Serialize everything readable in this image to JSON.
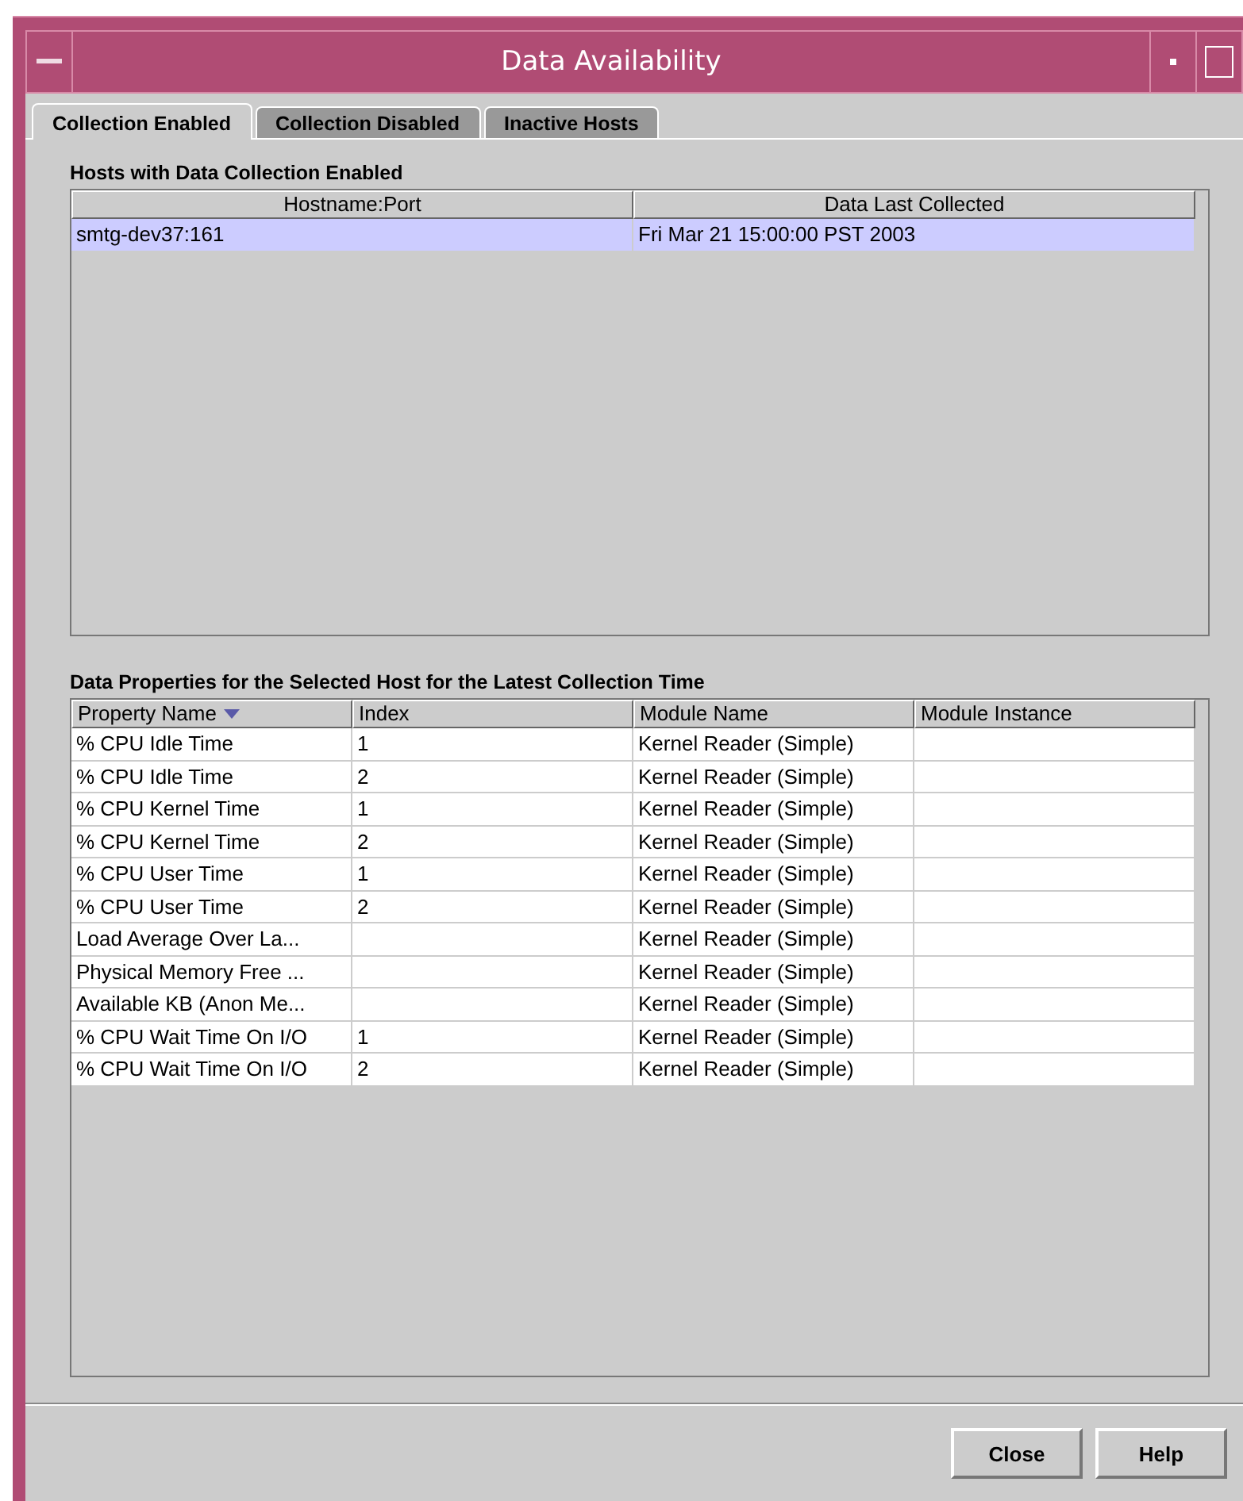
{
  "window": {
    "title": "Data Availability"
  },
  "tabs": [
    {
      "label": "Collection Enabled",
      "selected": true
    },
    {
      "label": "Collection Disabled",
      "selected": false
    },
    {
      "label": "Inactive Hosts",
      "selected": false
    }
  ],
  "hosts": {
    "title": "Hosts with Data Collection Enabled",
    "columns": [
      {
        "label": "Hostname:Port"
      },
      {
        "label": "Data Last Collected"
      }
    ],
    "rows": [
      {
        "selected": true,
        "cells": [
          "smtg-dev37:161",
          "Fri Mar 21 15:00:00 PST 2003"
        ]
      }
    ]
  },
  "properties": {
    "title": "Data Properties for the Selected Host for the Latest Collection Time",
    "columns": [
      {
        "label": "Property Name",
        "sorted": true
      },
      {
        "label": "Index",
        "sorted": false
      },
      {
        "label": "Module Name",
        "sorted": false
      },
      {
        "label": "Module Instance",
        "sorted": false
      }
    ],
    "rows": [
      {
        "selected": false,
        "cells": [
          "% CPU Idle Time",
          "1",
          "Kernel Reader (Simple)",
          ""
        ]
      },
      {
        "selected": false,
        "cells": [
          "% CPU Idle Time",
          "2",
          "Kernel Reader (Simple)",
          ""
        ]
      },
      {
        "selected": false,
        "cells": [
          "% CPU Kernel Time",
          "1",
          "Kernel Reader (Simple)",
          ""
        ]
      },
      {
        "selected": false,
        "cells": [
          "% CPU Kernel Time",
          "2",
          "Kernel Reader (Simple)",
          ""
        ]
      },
      {
        "selected": false,
        "cells": [
          "% CPU User Time",
          "1",
          "Kernel Reader (Simple)",
          ""
        ]
      },
      {
        "selected": false,
        "cells": [
          "% CPU User Time",
          "2",
          "Kernel Reader (Simple)",
          ""
        ]
      },
      {
        "selected": false,
        "cells": [
          "Load Average Over La...",
          "",
          "Kernel Reader (Simple)",
          ""
        ]
      },
      {
        "selected": false,
        "cells": [
          "Physical Memory Free ...",
          "",
          "Kernel Reader (Simple)",
          ""
        ]
      },
      {
        "selected": false,
        "cells": [
          "Available KB (Anon Me...",
          "",
          "Kernel Reader (Simple)",
          ""
        ]
      },
      {
        "selected": false,
        "cells": [
          "% CPU Wait Time On I/O",
          "1",
          "Kernel Reader (Simple)",
          ""
        ]
      },
      {
        "selected": false,
        "cells": [
          "% CPU Wait Time On I/O",
          "2",
          "Kernel Reader (Simple)",
          ""
        ]
      }
    ]
  },
  "buttons": [
    {
      "label": "Close"
    },
    {
      "label": "Help"
    }
  ]
}
